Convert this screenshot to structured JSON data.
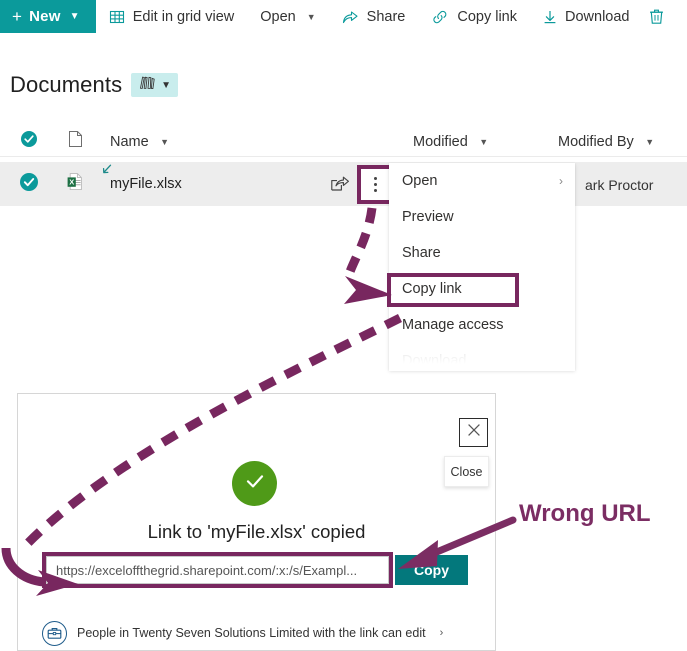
{
  "commandbar": {
    "new_button": {
      "label": "New",
      "icon": "plus-icon",
      "chevron": "chevron-down-icon"
    },
    "items": [
      {
        "label": "Edit in grid view",
        "icon": "grid-icon",
        "has_chevron": false
      },
      {
        "label": "Open",
        "icon": "",
        "has_chevron": true
      },
      {
        "label": "Share",
        "icon": "share-icon",
        "has_chevron": false
      },
      {
        "label": "Copy link",
        "icon": "link-icon",
        "has_chevron": false
      },
      {
        "label": "Download",
        "icon": "download-icon",
        "has_chevron": false
      }
    ],
    "delete_icon": "trash-icon"
  },
  "library": {
    "title": "Documents",
    "view_icon": "books-icon",
    "view_chevron": "chevron-down-icon"
  },
  "list": {
    "headers": {
      "select_all_icon": "check-circle-icon",
      "type_icon": "document-icon",
      "name": "Name",
      "modified": "Modified",
      "modified_by": "Modified By"
    },
    "rows": [
      {
        "selected": true,
        "file_icon": "excel-icon",
        "name": "myFile.xlsx",
        "sync_glyph": "shared-arrow-icon",
        "modified": "",
        "modified_by": "ark Proctor",
        "share_icon": "share-icon",
        "more_icon": "more-vertical-icon"
      }
    ]
  },
  "context_menu": {
    "items": [
      {
        "label": "Open",
        "submenu": true,
        "highlighted": false,
        "faded": false
      },
      {
        "label": "Preview",
        "submenu": false,
        "highlighted": false,
        "faded": false
      },
      {
        "label": "Share",
        "submenu": false,
        "highlighted": false,
        "faded": false
      },
      {
        "label": "Copy link",
        "submenu": false,
        "highlighted": true,
        "faded": false
      },
      {
        "label": "Manage access",
        "submenu": false,
        "highlighted": false,
        "faded": false
      },
      {
        "label": "Download",
        "submenu": false,
        "highlighted": false,
        "faded": true
      }
    ]
  },
  "share_dialog": {
    "heading": "Link to 'myFile.xlsx' copied",
    "success_icon": "checkmark-icon",
    "url_value": "https://exceloffthegrid.sharepoint.com/:x:/s/Exampl...",
    "copy_button": "Copy",
    "permission_text": "People in Twenty Seven Solutions Limited with the link can edit",
    "permission_icon": "briefcase-icon",
    "permission_chevron": "chevron-right-icon",
    "close_icon": "close-icon",
    "close_tooltip": "Close"
  },
  "annotations": {
    "wrong_url_label": "Wrong URL"
  },
  "colors": {
    "teal": "#0b9a9b",
    "teal_dark": "#03787c",
    "purple": "#7b2d63",
    "purple_box": "#78275f",
    "green": "#4f9a18",
    "excel_green": "#1d7044",
    "row_selected": "#ededed"
  }
}
